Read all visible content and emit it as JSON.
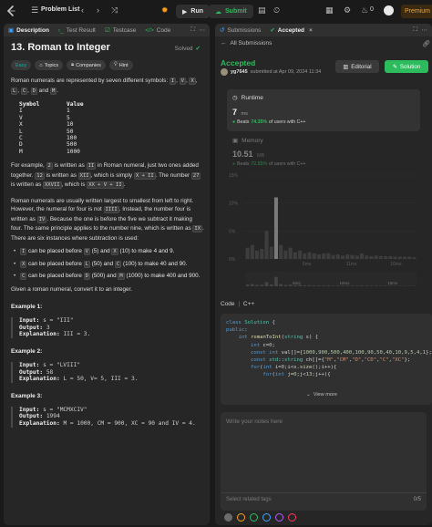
{
  "topbar": {
    "problem_list": "Problem List",
    "run": "Run",
    "submit": "Submit",
    "streak": "0",
    "premium": "Premium"
  },
  "left": {
    "tabs": [
      "Description",
      "Test Result",
      "Testcase",
      "Code"
    ],
    "title": "13. Roman to Integer",
    "solved": "Solved",
    "chips": [
      "Easy",
      "Topics",
      "Companies",
      "Hint"
    ],
    "intro": "Roman numerals are represented by seven different symbols:",
    "intro_symbols": [
      "I",
      "V",
      "X",
      "L",
      "C",
      "D",
      "M"
    ],
    "table_header": [
      "Symbol",
      "Value"
    ],
    "table_rows": [
      [
        "I",
        "1"
      ],
      [
        "V",
        "5"
      ],
      [
        "X",
        "10"
      ],
      [
        "L",
        "50"
      ],
      [
        "C",
        "100"
      ],
      [
        "D",
        "500"
      ],
      [
        "M",
        "1000"
      ]
    ],
    "p2": [
      "For example, ",
      "2",
      " is written as ",
      "II",
      " in Roman numeral, just two ones added together. ",
      "12",
      " is written as ",
      "XII",
      ", which is simply ",
      "X + II",
      ". The number ",
      "27",
      " is written as ",
      "XXVII",
      ", which is ",
      "XX + V + II",
      "."
    ],
    "p3": [
      "Roman numerals are usually written largest to smallest from left to right. However, the numeral for four is not ",
      "IIII",
      ". Instead, the number four is written as ",
      "IV",
      ". Because the one is before the five we subtract it making four. The same principle applies to the number nine, which is written as ",
      "IX",
      ". There are six instances where subtraction is used:"
    ],
    "bullets": [
      [
        "",
        "I",
        " can be placed before ",
        "V",
        " (5) and ",
        "X",
        " (10) to make 4 and 9."
      ],
      [
        "",
        "X",
        " can be placed before ",
        "L",
        " (50) and ",
        "C",
        " (100) to make 40 and 90."
      ],
      [
        "",
        "C",
        " can be placed before ",
        "D",
        " (500) and ",
        "M",
        " (1000) to make 400 and 900."
      ]
    ],
    "closing": "Given a roman numeral, convert it to an integer.",
    "examples": [
      {
        "title": "Example 1:",
        "input": "s = \"III\"",
        "output": "3",
        "explanation": "III = 3."
      },
      {
        "title": "Example 2:",
        "input": "s = \"LVIII\"",
        "output": "58",
        "explanation": "L = 50, V= 5, III = 3."
      },
      {
        "title": "Example 3:",
        "input": "s = \"MCMXCIV\"",
        "output": "1994",
        "explanation": "M = 1000, CM = 900, XC = 90 and IV = 4."
      }
    ],
    "labels": {
      "input": "Input:",
      "output": "Output:",
      "explanation": "Explanation:"
    }
  },
  "right": {
    "tabs": [
      "Submissions",
      "Accepted"
    ],
    "all_submissions": "All Submissions",
    "status": "Accepted",
    "author": "yg7645",
    "submitted": "submitted at Apr 09, 2024 11:34",
    "editorial": "Editorial",
    "solution": "Solution",
    "runtime": {
      "label": "Runtime",
      "value": "7",
      "unit": "ms",
      "beats": "Beats",
      "pct": "74.35%",
      "suffix": "of users with C++"
    },
    "memory": {
      "label": "Memory",
      "value": "10.51",
      "unit": "MB",
      "beats": "Beats",
      "pct": "72.55%",
      "suffix": "of users with C++"
    },
    "chart_data": {
      "type": "bar",
      "yticks": [
        "15%",
        "10%",
        "5%",
        "0%"
      ],
      "xticks": [
        "6ms",
        "11ms",
        "16ms"
      ],
      "ylim": [
        0,
        15
      ],
      "values": [
        2,
        2.5,
        1.5,
        1.8,
        5,
        2.2,
        11,
        2.5,
        1.5,
        2,
        1.2,
        1.5,
        1,
        1.2,
        1,
        0.8,
        1,
        1,
        0.7,
        0.8,
        0.6,
        0.8,
        0.7,
        0.6,
        1,
        0.6,
        0.5,
        0.6,
        0.5,
        0.5,
        0.5,
        0.4,
        0.4,
        0.4,
        0.4,
        0.3
      ],
      "highlight_index": 6,
      "mini_labels": [
        "5ms",
        "10ms",
        "16ms"
      ]
    },
    "code_label": "Code",
    "lang": "C++",
    "view_more": "View more",
    "notes_placeholder": "Write your notes here",
    "tags_placeholder": "Select related tags",
    "tags_count": "0/5",
    "colors": [
      "#6b6b6b",
      "#ffa116",
      "#2cbb5d",
      "#3ea6ff",
      "#b659ff",
      "#ff375f"
    ]
  }
}
